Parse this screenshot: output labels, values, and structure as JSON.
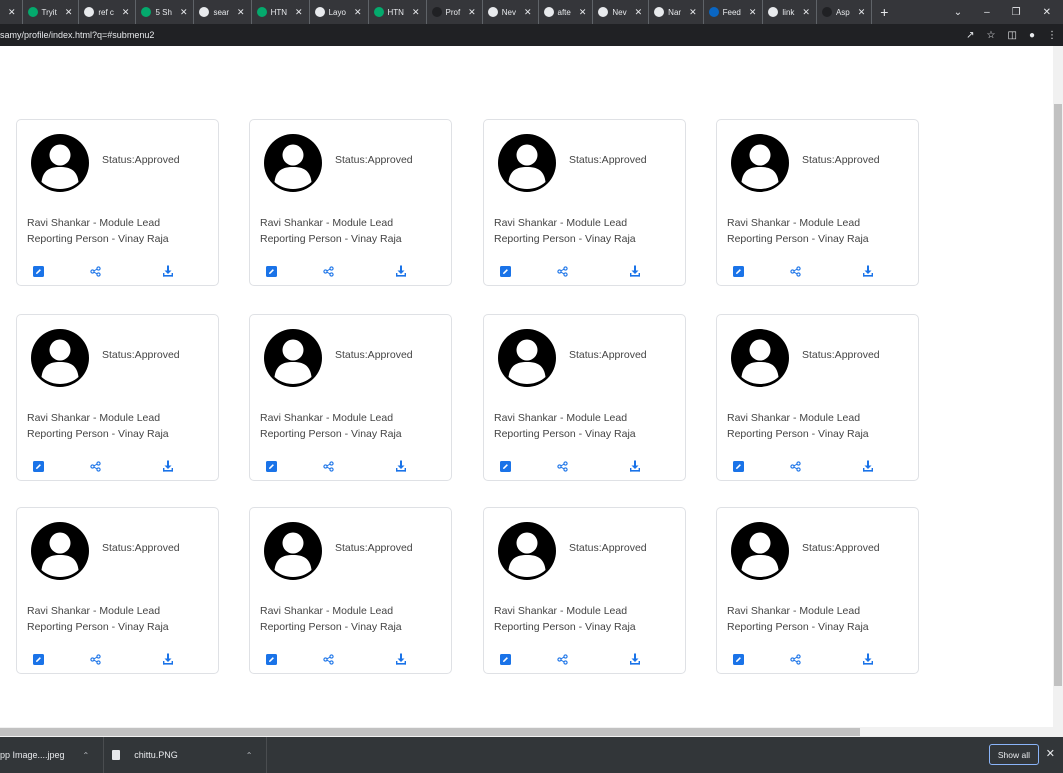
{
  "browser": {
    "tabs": [
      {
        "label": "",
        "icon": "blank-tab-icon",
        "color": "#9aa0a6"
      },
      {
        "label": "Tryit",
        "icon": "w3schools-icon",
        "color": "#04aa6d"
      },
      {
        "label": "ref c",
        "icon": "google-icon",
        "color": "#e8eaed"
      },
      {
        "label": "5 Sh",
        "icon": "w3schools-icon",
        "color": "#04aa6d"
      },
      {
        "label": "sear",
        "icon": "google-icon",
        "color": "#e8eaed"
      },
      {
        "label": "HTN",
        "icon": "w3schools-icon",
        "color": "#04aa6d"
      },
      {
        "label": "Layo",
        "icon": "globe-icon",
        "color": "#e8eaed"
      },
      {
        "label": "HTN",
        "icon": "w3schools-icon",
        "color": "#04aa6d"
      },
      {
        "label": "Prof",
        "icon": "github-icon",
        "color": "#202124"
      },
      {
        "label": "Nev",
        "icon": "smiley-icon",
        "color": "#e8eaed"
      },
      {
        "label": "afte",
        "icon": "google-icon",
        "color": "#e8eaed"
      },
      {
        "label": "Nev",
        "icon": "chrome-icon",
        "color": "#e8eaed"
      },
      {
        "label": "Nar",
        "icon": "google-icon",
        "color": "#e8eaed"
      },
      {
        "label": "Feed",
        "icon": "linkedin-icon",
        "color": "#0a66c2"
      },
      {
        "label": "link",
        "icon": "google-icon",
        "color": "#e8eaed"
      },
      {
        "label": "Asp",
        "icon": "github-icon",
        "color": "#202124"
      }
    ],
    "url": "samy/profile/index.html?q=#submenu2"
  },
  "cards": [
    {
      "status": "Status:Approved",
      "name": "Ravi Shankar - Module Lead",
      "reporting": "Reporting Person - Vinay Raja"
    },
    {
      "status": "Status:Approved",
      "name": "Ravi Shankar - Module Lead",
      "reporting": "Reporting Person - Vinay Raja"
    },
    {
      "status": "Status:Approved",
      "name": "Ravi Shankar - Module Lead",
      "reporting": "Reporting Person - Vinay Raja"
    },
    {
      "status": "Status:Approved",
      "name": "Ravi Shankar - Module Lead",
      "reporting": "Reporting Person - Vinay Raja"
    },
    {
      "status": "Status:Approved",
      "name": "Ravi Shankar - Module Lead",
      "reporting": "Reporting Person - Vinay Raja"
    },
    {
      "status": "Status:Approved",
      "name": "Ravi Shankar - Module Lead",
      "reporting": "Reporting Person - Vinay Raja"
    },
    {
      "status": "Status:Approved",
      "name": "Ravi Shankar - Module Lead",
      "reporting": "Reporting Person - Vinay Raja"
    },
    {
      "status": "Status:Approved",
      "name": "Ravi Shankar - Module Lead",
      "reporting": "Reporting Person - Vinay Raja"
    },
    {
      "status": "Status:Approved",
      "name": "Ravi Shankar - Module Lead",
      "reporting": "Reporting Person - Vinay Raja"
    },
    {
      "status": "Status:Approved",
      "name": "Ravi Shankar - Module Lead",
      "reporting": "Reporting Person - Vinay Raja"
    },
    {
      "status": "Status:Approved",
      "name": "Ravi Shankar - Module Lead",
      "reporting": "Reporting Person - Vinay Raja"
    },
    {
      "status": "Status:Approved",
      "name": "Ravi Shankar - Module Lead",
      "reporting": "Reporting Person - Vinay Raja"
    }
  ],
  "colors": {
    "accent": "#1a73e8",
    "avatar": "#000000"
  },
  "downloads": {
    "items": [
      {
        "label": "pp Image....jpeg"
      },
      {
        "label": "chittu.PNG"
      }
    ],
    "show_all_label": "Show all"
  }
}
